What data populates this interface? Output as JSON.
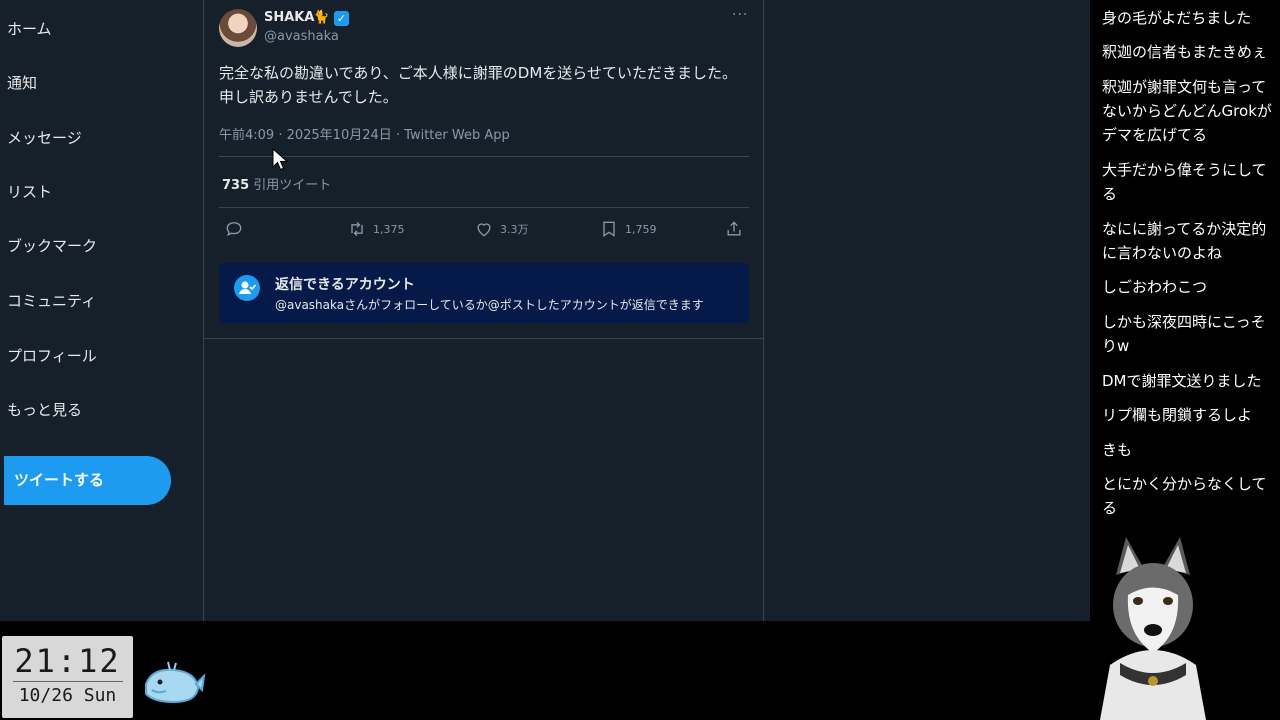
{
  "nav": {
    "items": [
      {
        "label": "ホーム"
      },
      {
        "label": "通知"
      },
      {
        "label": "メッセージ"
      },
      {
        "label": "リスト"
      },
      {
        "label": "ブックマーク"
      },
      {
        "label": "コミュニティ"
      },
      {
        "label": "プロフィール"
      },
      {
        "label": "もっと見る"
      }
    ],
    "tweet_button": "ツイートする"
  },
  "tweet": {
    "display_name": "SHAKA",
    "handle": "@avashaka",
    "text": "完全な私の勘違いであり、ご本人様に謝罪のDMを送らせていただきました。申し訳ありませんでした。",
    "meta": "午前4:09 · 2025年10月24日 · Twitter Web App",
    "quote_count": "735",
    "quote_label": "引用ツイート",
    "retweets": "1,375",
    "likes": "3.3万",
    "bookmarks": "1,759",
    "reply_banner": {
      "title": "返信できるアカウント",
      "description": "@avashakaさんがフォローしているか@ポストしたアカウントが返信できます"
    }
  },
  "comments": [
    "身の毛がよだちました",
    "釈迦の信者もまたきめぇ",
    "釈迦が謝罪文何も言ってないからどんどんGrokがデマを広げてる",
    "大手だから偉そうにしてる",
    "なにに謝ってるか決定的に言わないのよね",
    "しごおわわこつ",
    "しかも深夜四時にこっそりw",
    "DMで謝罪文送りました",
    "リプ欄も閉鎖するしよ",
    "きも",
    "とにかく分からなくしてる"
  ],
  "clock": {
    "time": "21:12",
    "date": "10/26 Sun"
  },
  "colors": {
    "background": "#15202b",
    "accent": "#1d9bf0",
    "banner": "#051a48"
  }
}
